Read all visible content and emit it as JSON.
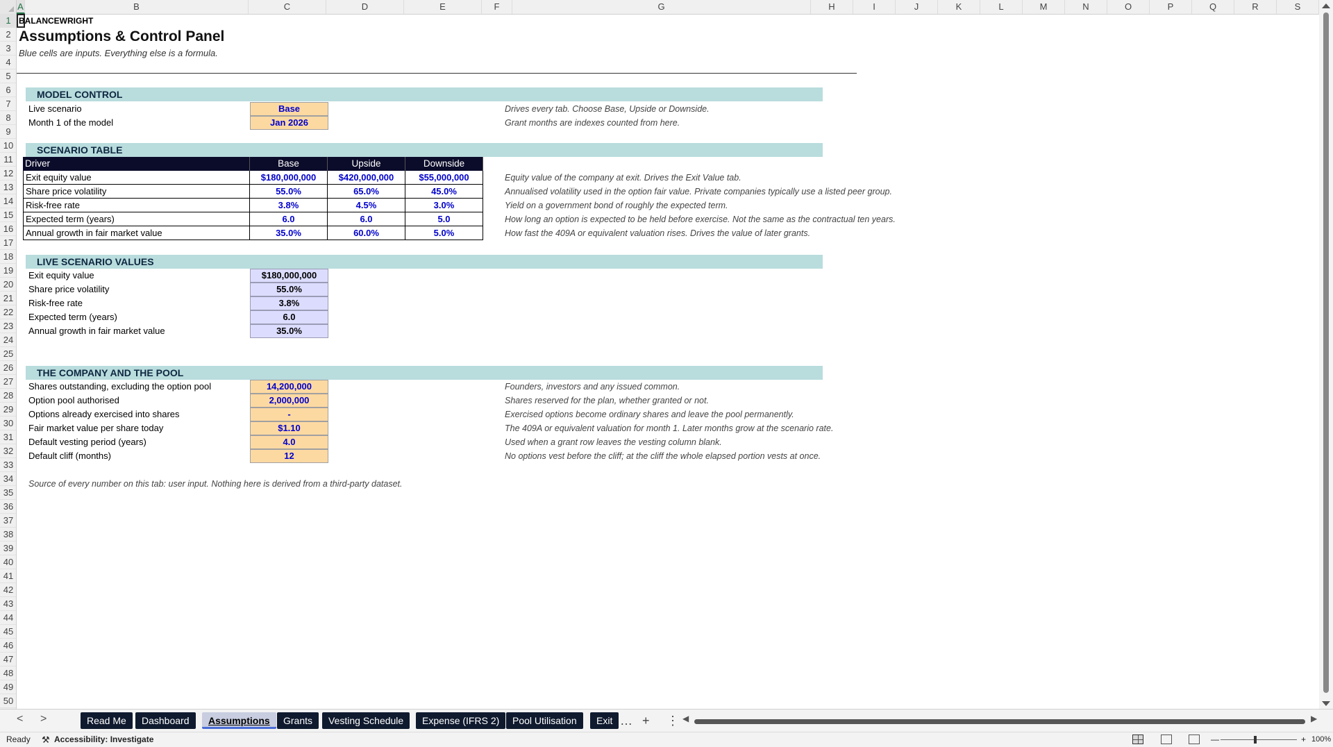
{
  "columns": [
    "A",
    "B",
    "C",
    "D",
    "E",
    "F",
    "G",
    "H",
    "I",
    "J",
    "K",
    "L",
    "M",
    "N",
    "O",
    "P",
    "Q",
    "R",
    "S"
  ],
  "rows_count": 50,
  "selected_cell": "A1",
  "colors": {
    "section_fill": "#b9dcdd",
    "input_fill": "#fdd9a2",
    "calc_fill": "#dcdcff",
    "table_header": "#0b0b2a",
    "input_text": "#0000cc"
  },
  "header": {
    "brand": "BALANCEWRIGHT",
    "title": "Assumptions & Control Panel",
    "subtitle": "Blue cells are inputs. Everything else is a formula."
  },
  "model_control": {
    "heading": "MODEL CONTROL",
    "rows": [
      {
        "label": "Live scenario",
        "value": "Base",
        "note": "Drives every tab. Choose Base, Upside or Downside."
      },
      {
        "label": "Month 1 of the model",
        "value": "Jan 2026",
        "note": "Grant months are indexes counted from here."
      }
    ]
  },
  "scenario_table": {
    "heading": "SCENARIO TABLE",
    "columns": [
      "Driver",
      "Base",
      "Upside",
      "Downside"
    ],
    "rows": [
      {
        "driver": "Exit equity value",
        "base": "$180,000,000",
        "upside": "$420,000,000",
        "downside": "$55,000,000",
        "note": "Equity value of the company at exit. Drives the Exit Value tab."
      },
      {
        "driver": "Share price volatility",
        "base": "55.0%",
        "upside": "65.0%",
        "downside": "45.0%",
        "note": "Annualised volatility used in the option fair value. Private companies typically use a listed peer group."
      },
      {
        "driver": "Risk-free rate",
        "base": "3.8%",
        "upside": "4.5%",
        "downside": "3.0%",
        "note": "Yield on a government bond of roughly the expected term."
      },
      {
        "driver": "Expected term (years)",
        "base": "6.0",
        "upside": "6.0",
        "downside": "5.0",
        "note": "How long an option is expected to be held before exercise. Not the same as the contractual ten years."
      },
      {
        "driver": "Annual growth in fair market value",
        "base": "35.0%",
        "upside": "60.0%",
        "downside": "5.0%",
        "note": "How fast the 409A or equivalent valuation rises. Drives the value of later grants."
      }
    ]
  },
  "live_values": {
    "heading": "LIVE SCENARIO VALUES",
    "rows": [
      {
        "label": "Exit equity value",
        "value": "$180,000,000"
      },
      {
        "label": "Share price volatility",
        "value": "55.0%"
      },
      {
        "label": "Risk-free rate",
        "value": "3.8%"
      },
      {
        "label": "Expected term (years)",
        "value": "6.0"
      },
      {
        "label": "Annual growth in fair market value",
        "value": "35.0%"
      }
    ]
  },
  "company_pool": {
    "heading": "THE COMPANY AND THE POOL",
    "rows": [
      {
        "label": "Shares outstanding, excluding the option pool",
        "value": "14,200,000",
        "note": "Founders, investors and any issued common."
      },
      {
        "label": "Option pool authorised",
        "value": "2,000,000",
        "note": "Shares reserved for the plan, whether granted or not."
      },
      {
        "label": "Options already exercised into shares",
        "value": "-",
        "note": "Exercised options become ordinary shares and leave the pool permanently."
      },
      {
        "label": "Fair market value per share today",
        "value": "$1.10",
        "note": "The 409A or equivalent valuation for month 1. Later months grow at the scenario rate."
      },
      {
        "label": "Default vesting period (years)",
        "value": "4.0",
        "note": "Used when a grant row leaves the vesting column blank."
      },
      {
        "label": "Default cliff (months)",
        "value": "12",
        "note": "No options vest before the cliff; at the cliff the whole elapsed portion vests at once."
      }
    ]
  },
  "source_note": "Source of every number on this tab: user input. Nothing here is derived from a third-party dataset.",
  "tabs": [
    {
      "label": "Read Me",
      "active": false
    },
    {
      "label": "Dashboard",
      "active": false
    },
    {
      "label": "Assumptions",
      "active": true
    },
    {
      "label": "Grants",
      "active": false
    },
    {
      "label": "Vesting Schedule",
      "active": false
    },
    {
      "label": "Expense (IFRS 2)",
      "active": false
    },
    {
      "label": "Pool Utilisation",
      "active": false
    },
    {
      "label": "Exit",
      "active": false
    }
  ],
  "tabbar": {
    "more": "…",
    "add": "+",
    "options": "⋮",
    "prev": "<",
    "next": ">"
  },
  "status": {
    "ready": "Ready",
    "accessibility": "Accessibility: Investigate",
    "zoom_minus": "—",
    "zoom_plus": "+",
    "zoom": "100%"
  }
}
